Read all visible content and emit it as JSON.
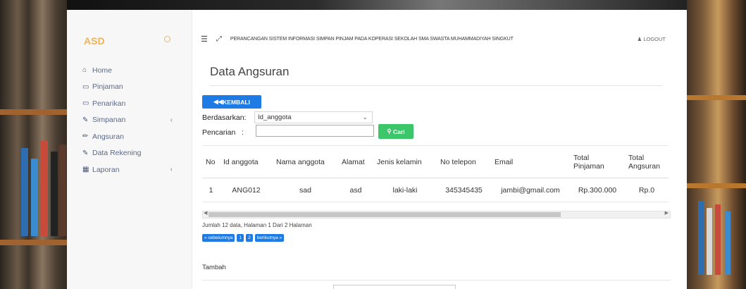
{
  "sidebar": {
    "brand": "ASD",
    "items": [
      {
        "icon": "home-icon",
        "glyph": "⌂",
        "label": "Home",
        "chevron": ""
      },
      {
        "icon": "card-icon",
        "glyph": "▭",
        "label": "Pinjaman",
        "chevron": ""
      },
      {
        "icon": "card-icon",
        "glyph": "▭",
        "label": "Penarikan",
        "chevron": ""
      },
      {
        "icon": "edit-icon",
        "glyph": "✎",
        "label": "Simpanan",
        "chevron": "‹"
      },
      {
        "icon": "pencil-icon",
        "glyph": "✏",
        "label": "Angsuran",
        "chevron": ""
      },
      {
        "icon": "edit-icon",
        "glyph": "✎",
        "label": "Data Rekening",
        "chevron": ""
      },
      {
        "icon": "calendar-icon",
        "glyph": "▦",
        "label": "Laporan",
        "chevron": "‹"
      }
    ]
  },
  "header": {
    "title": "PERANCANGAN SISTEM INFORMASI SIMPAN PINJAM PADA KOPERASI SEKOLAH SMA SWASTA MUHAMMADIYAH SINGKUT",
    "logout": "LOGOUT"
  },
  "page": {
    "title": "Data Angsuran",
    "back_button": "KEMBALI",
    "filter_label": "Berdasarkan:",
    "filter_value": "Id_anggota",
    "search_label": "Pencarian",
    "search_colon": ":",
    "search_value": "",
    "search_button": "Cari"
  },
  "table": {
    "headers": [
      "No",
      "Id anggota",
      "Nama anggota",
      "Alamat",
      "Jenis kelamin",
      "No telepon",
      "Email",
      "Total Pinjaman",
      "Total Angsuran"
    ],
    "rows": [
      [
        "1",
        "ANG012",
        "sad",
        "asd",
        "laki-laki",
        "345345435",
        "jambi@gmail.com",
        "Rp.300.000",
        "Rp.0"
      ]
    ]
  },
  "summary": "Jumlah 12 data, Halaman 1 Dari 2 Halaman",
  "pagination": [
    "« sebelumnya",
    "1",
    "2",
    "berikutnya »"
  ],
  "form": {
    "title": "Tambah"
  },
  "colors": {
    "brand": "#f0b25a",
    "primary": "#1e7be6",
    "success": "#3cc66a"
  }
}
